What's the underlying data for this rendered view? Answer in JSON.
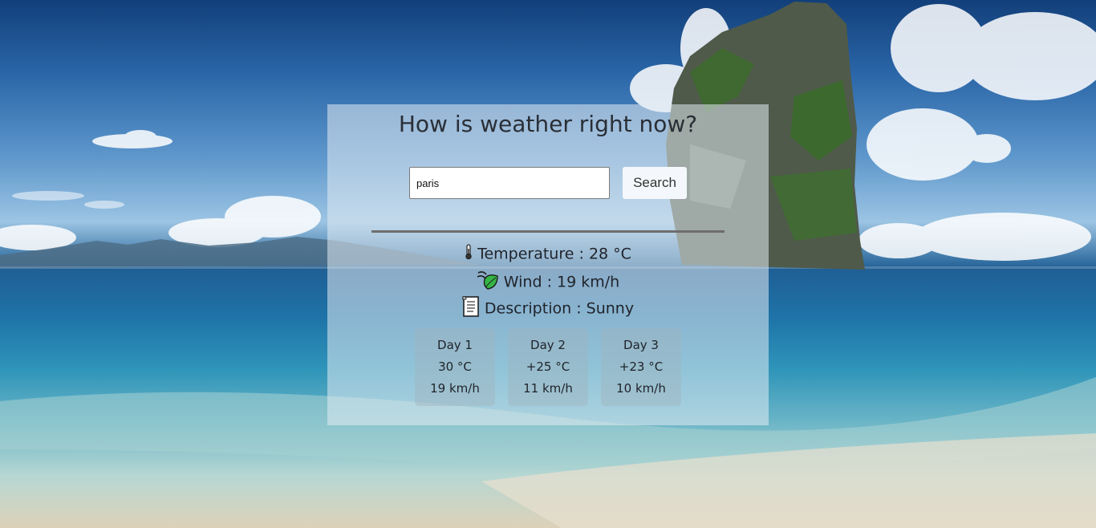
{
  "page": {
    "title": "How is weather right now?"
  },
  "search": {
    "value": "paris",
    "button_label": "Search"
  },
  "current": {
    "temperature": {
      "icon": "thermometer-icon",
      "label": "Temperature",
      "separator": ":",
      "value": "28 °C"
    },
    "wind": {
      "icon": "wind-leaf-icon",
      "label": "Wind",
      "separator": ":",
      "value": "19 km/h"
    },
    "description": {
      "icon": "document-icon",
      "label": "Description",
      "separator": ":",
      "value": "Sunny"
    }
  },
  "forecast": [
    {
      "day": "Day 1",
      "temp": "30 °C",
      "wind": "19 km/h"
    },
    {
      "day": "Day 2",
      "temp": "+25 °C",
      "wind": "11 km/h"
    },
    {
      "day": "Day 3",
      "temp": "+23 °C",
      "wind": "10 km/h"
    }
  ],
  "colors": {
    "sky": "#2a66a8",
    "sea": "#1e73a8",
    "sand": "#ddd2b8",
    "card": "#e1ebf2",
    "divider": "#6e6e6e"
  }
}
